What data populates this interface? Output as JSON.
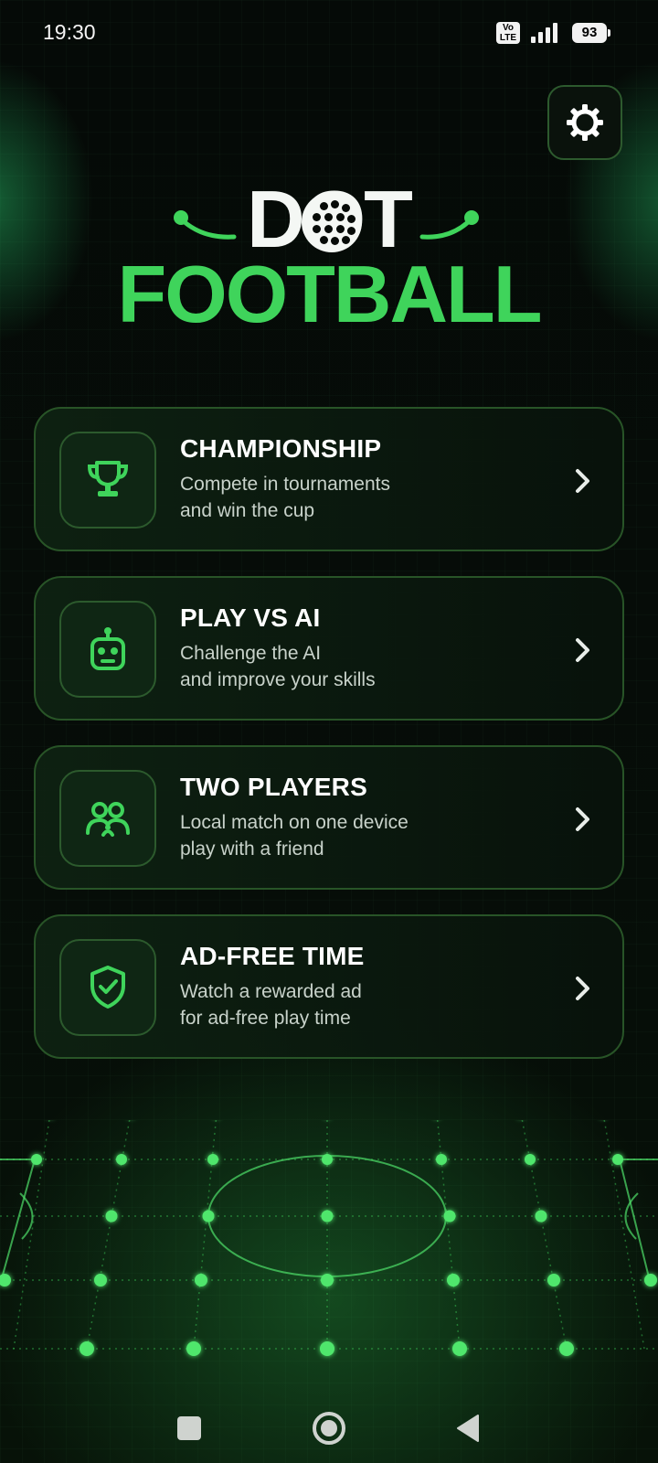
{
  "status_bar": {
    "time": "19:30",
    "volte_top": "Vo",
    "volte_bottom": "LTE",
    "battery": "93",
    "signal_bars": 4
  },
  "settings": {
    "icon": "gear-icon"
  },
  "logo": {
    "line1": "DOT",
    "line2": "FOOTBALL",
    "ball_icon": "football-icon"
  },
  "colors": {
    "accent": "#3fd45b",
    "card_border": "#285427",
    "background": "#040806"
  },
  "menu": {
    "items": [
      {
        "title": "CHAMPIONSHIP",
        "description": "Compete in tournaments\nand win the cup",
        "icon": "trophy-icon"
      },
      {
        "title": "PLAY VS AI",
        "description": "Challenge the AI\nand improve your skills",
        "icon": "robot-icon"
      },
      {
        "title": "TWO PLAYERS",
        "description": "Local match on one device\nplay with a friend",
        "icon": "two-players-icon"
      },
      {
        "title": "AD-FREE TIME",
        "description": "Watch a rewarded ad\nfor ad-free play time",
        "icon": "shield-check-icon"
      }
    ]
  },
  "nav": {
    "recents_icon": "square-icon",
    "home_icon": "circle-icon",
    "back_icon": "back-triangle-icon"
  }
}
